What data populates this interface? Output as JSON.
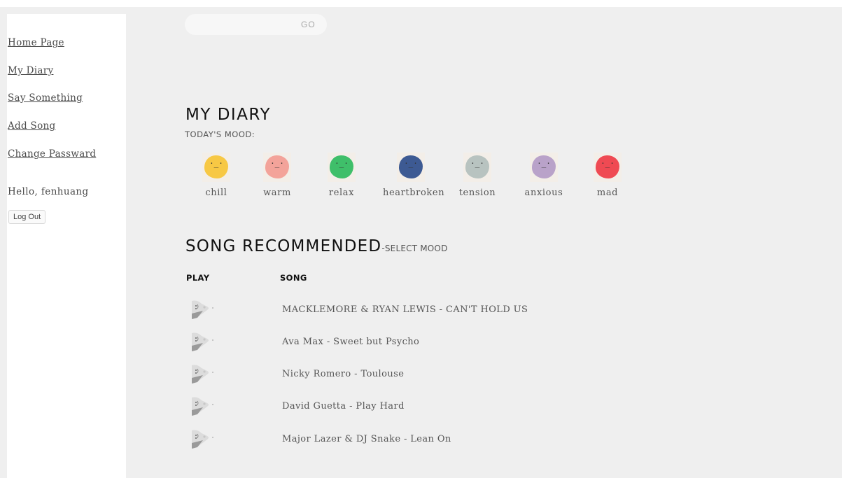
{
  "sidebar": {
    "nav": [
      {
        "label": "Home Page"
      },
      {
        "label": "My Diary"
      },
      {
        "label": "Say Something"
      },
      {
        "label": "Add Song"
      },
      {
        "label": "Change Passward"
      }
    ],
    "greeting": "Hello,  fenhuang",
    "logout_label": "Log Out"
  },
  "search": {
    "value": "",
    "button_label": "GO"
  },
  "diary": {
    "title": "MY DIARY",
    "mood_prompt": "TODAY'S MOOD:",
    "moods": [
      {
        "label": "chill",
        "color": "#f7c844",
        "face": "·_·",
        "icon": "smile-face-icon"
      },
      {
        "label": "warm",
        "color": "#f3a39a",
        "face": "·_·",
        "icon": "smile-face-icon"
      },
      {
        "label": "relax",
        "color": "#3fbf6a",
        "face": "·_·",
        "icon": "calm-face-icon"
      },
      {
        "label": "heartbroken",
        "color": "#3d5a93",
        "face": "·_·",
        "icon": "sad-face-icon"
      },
      {
        "label": "tension",
        "color": "#b8c3c0",
        "face": "·_·",
        "icon": "tense-face-icon"
      },
      {
        "label": "anxious",
        "color": "#b9a2c9",
        "face": "·_·",
        "icon": "worried-face-icon"
      },
      {
        "label": "mad",
        "color": "#ef4a53",
        "face": "·_·",
        "icon": "angry-face-icon"
      }
    ]
  },
  "songs": {
    "title": "SONG RECOMMENDED",
    "subtitle": "-SELECT MOOD",
    "columns": {
      "play": "PLAY",
      "song": "SONG"
    },
    "rows": [
      {
        "title": "MACKLEMORE & RYAN LEWIS - CAN'T HOLD US"
      },
      {
        "title": "Ava Max - Sweet but Psycho"
      },
      {
        "title": "Nicky Romero - Toulouse"
      },
      {
        "title": "David Guetta - Play Hard"
      },
      {
        "title": "Major Lazer & DJ Snake - Lean On"
      }
    ]
  }
}
